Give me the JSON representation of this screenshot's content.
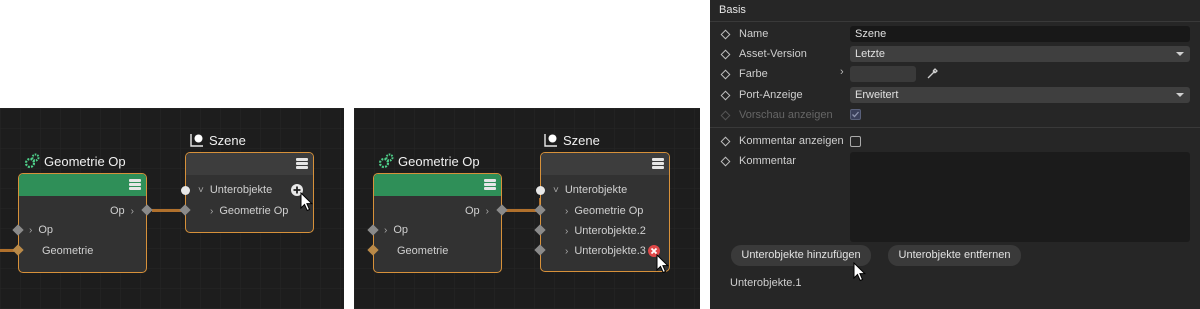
{
  "graph_before": {
    "geometry_node": {
      "title": "Geometrie Op",
      "output_label": "Op",
      "inputs": [
        "Op",
        "Geometrie"
      ]
    },
    "scene_node": {
      "title": "Szene",
      "group_label": "Unterobjekte",
      "children": [
        "Geometrie Op"
      ]
    }
  },
  "graph_after": {
    "geometry_node": {
      "title": "Geometrie Op",
      "output_label": "Op",
      "inputs": [
        "Op",
        "Geometrie"
      ]
    },
    "scene_node": {
      "title": "Szene",
      "group_label": "Unterobjekte",
      "children": [
        "Geometrie Op",
        "Unterobjekte.2",
        "Unterobjekte.3"
      ]
    }
  },
  "properties": {
    "section_title": "Basis",
    "rows": {
      "name_label": "Name",
      "name_value": "Szene",
      "asset_version_label": "Asset-Version",
      "asset_version_value": "Letzte",
      "color_label": "Farbe",
      "port_display_label": "Port-Anzeige",
      "port_display_value": "Erweitert",
      "preview_label": "Vorschau anzeigen",
      "show_comment_label": "Kommentar anzeigen",
      "comment_label": "Kommentar"
    },
    "add_button": "Unterobjekte hinzufügen",
    "remove_button": "Unterobjekte entfernen",
    "footer_item": "Unterobjekte.1"
  },
  "colors": {
    "node_border": "#d7913a",
    "geometry_header": "#2f8f58",
    "wire": "#b0702c",
    "remove_badge": "#e04848"
  },
  "icons": [
    "gears-icon",
    "scene-icon",
    "menu-icon",
    "add-icon",
    "remove-icon",
    "eyedropper-icon",
    "mouse-cursor-icon"
  ]
}
